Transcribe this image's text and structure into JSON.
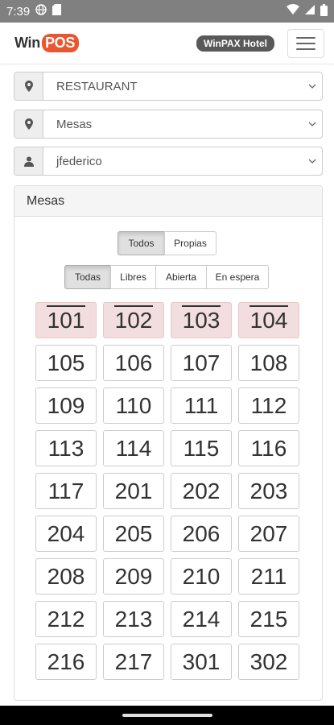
{
  "status": {
    "time": "7:39"
  },
  "brand": {
    "win": "Win",
    "pos": "POS"
  },
  "hotel_badge": "WinPAX Hotel",
  "selects": {
    "location": "RESTAURANT",
    "area": "Mesas",
    "user": "jfederico"
  },
  "panel": {
    "title": "Mesas"
  },
  "filter_owner": [
    "Todos",
    "Propias"
  ],
  "filter_state": [
    "Todas",
    "Libres",
    "Abierta",
    "En espera"
  ],
  "tables": [
    {
      "number": "101",
      "state": "open"
    },
    {
      "number": "102",
      "state": "open"
    },
    {
      "number": "103",
      "state": "open"
    },
    {
      "number": "104",
      "state": "open"
    },
    {
      "number": "105",
      "state": "free"
    },
    {
      "number": "106",
      "state": "free"
    },
    {
      "number": "107",
      "state": "free"
    },
    {
      "number": "108",
      "state": "free"
    },
    {
      "number": "109",
      "state": "free"
    },
    {
      "number": "110",
      "state": "free"
    },
    {
      "number": "111",
      "state": "free"
    },
    {
      "number": "112",
      "state": "free"
    },
    {
      "number": "113",
      "state": "free"
    },
    {
      "number": "114",
      "state": "free"
    },
    {
      "number": "115",
      "state": "free"
    },
    {
      "number": "116",
      "state": "free"
    },
    {
      "number": "117",
      "state": "free"
    },
    {
      "number": "201",
      "state": "free"
    },
    {
      "number": "202",
      "state": "free"
    },
    {
      "number": "203",
      "state": "free"
    },
    {
      "number": "204",
      "state": "free"
    },
    {
      "number": "205",
      "state": "free"
    },
    {
      "number": "206",
      "state": "free"
    },
    {
      "number": "207",
      "state": "free"
    },
    {
      "number": "208",
      "state": "free"
    },
    {
      "number": "209",
      "state": "free"
    },
    {
      "number": "210",
      "state": "free"
    },
    {
      "number": "211",
      "state": "free"
    },
    {
      "number": "212",
      "state": "free"
    },
    {
      "number": "213",
      "state": "free"
    },
    {
      "number": "214",
      "state": "free"
    },
    {
      "number": "215",
      "state": "free"
    },
    {
      "number": "216",
      "state": "free"
    },
    {
      "number": "217",
      "state": "free"
    },
    {
      "number": "301",
      "state": "free"
    },
    {
      "number": "302",
      "state": "free"
    }
  ],
  "colors": {
    "brand_accent": "#e9562f",
    "open_table": "#f2dede",
    "status_bar": "#808080"
  },
  "icons": {
    "location": "map-marker-icon",
    "area": "map-marker-icon",
    "user": "user-icon"
  }
}
